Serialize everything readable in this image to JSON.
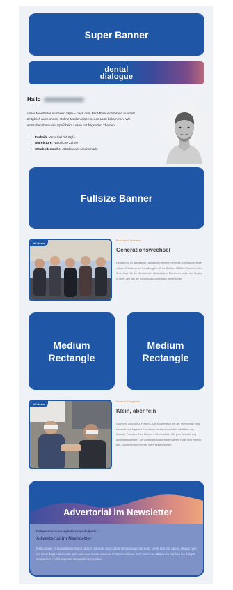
{
  "super_banner": {
    "label": "Super Banner"
  },
  "logo": {
    "line1": "dental",
    "line2": "dialogue"
  },
  "intro": {
    "greeting": "Hallo",
    "paragraph": "unser Newsletter im neuen Style – nach dem Print-Relaunch haben nun fast zeitgleich auch unsere Online-Medien einen neuen Look bekommen. Wir wünschen Ihnen viel Spaß beim Lesen mit folgenden Themen:",
    "bullets": [
      {
        "term": "Technik:",
        "text": "Vorverfall mit Style"
      },
      {
        "term": "Big Picture:",
        "text": "Natürliche Zähne"
      },
      {
        "term": "Mitarbeitersuche:",
        "text": "Attraktiv am Arbeitsmarkt"
      }
    ]
  },
  "fullsize_banner": {
    "label": "Fullsize Banner"
  },
  "articles": [
    {
      "badge": "## News",
      "kicker": "Branche & Umsätze",
      "title": "Generationswechsel",
      "body": "Dentaurum ist das älteste Dentalunternehmen der Welt. Dentaurum legte mit der Gründung am Schalburg Nr. 15 im Oktober 1886 in Pforzheim den Grundstein für die Medizintechnikindustrie in Pforzheim und in der Region in einer Zeit, als die Schmuckindustrie alles beherrschte."
    },
    {
      "badge": "## News",
      "kicker": "Kurse & Kongresse",
      "title": "Klein, aber fein",
      "body": "Scannen, Drucken & Fräsen – Die Kooperation mit der Firma ebay zeigt erstmals das folgende Fachdetail für den kompletten Workflow von Mobase Premium. Neu können Frühmaschinen für jede Anforderung angeboten werden. Die Digitalisierung erfordert weiter voran und eröffnet den Zahntechnikern immer mehr Möglichkeiten."
    }
  ],
  "medium_rectangles": [
    {
      "line1": "Medium",
      "line2": "Rectangle"
    },
    {
      "line1": "Medium",
      "line2": "Rectangle"
    }
  ],
  "advertorial": {
    "title": "Advertorial im Newsletter",
    "kicker": "Ratquuntiae re nusapitatius reped ulparis",
    "subtitle": "Advertorial im Newsletter",
    "body": "Ratquuntiae re nusapitatius reped ulparis dem nus sit occabor simirumqui volut eum, conet atur, ius aperia struqui nam vel intem fugit maionsuda quis nam que mente eassum re sConn milique vent venim ad utlaborum red lout ius dolupta temporeum reshil imporest doluptatis re postibus."
  },
  "colors": {
    "brand_blue": "#1f57a6",
    "kicker_orange": "#e68a3a",
    "page_bg": "#eef1f5"
  }
}
